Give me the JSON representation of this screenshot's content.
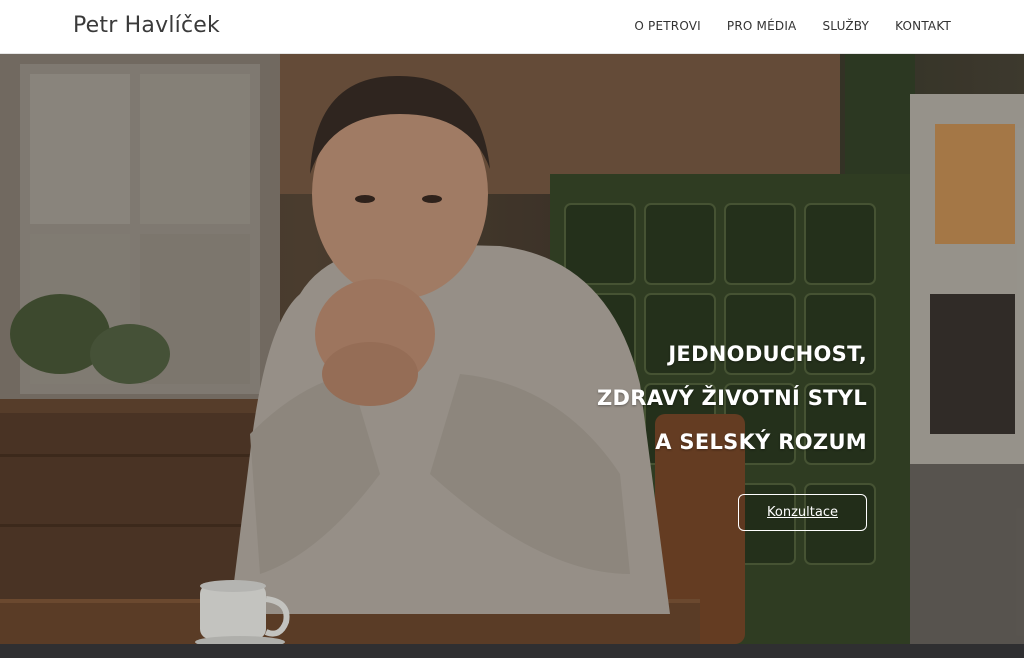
{
  "header": {
    "logo": "Petr Havlíček",
    "nav": [
      "O PETROVI",
      "PRO MÉDIA",
      "SLUŽBY",
      "KONTAKT"
    ]
  },
  "hero": {
    "lines": [
      "JEDNODUCHOST,",
      "ZDRAVÝ ŽIVOTNÍ STYL",
      "A SELSKÝ ROZUM"
    ],
    "cta_label": "Konzultace"
  },
  "colors": {
    "header_bg": "#ffffff",
    "hero_text": "#ffffff",
    "footer_strip": "#2f2f31"
  }
}
